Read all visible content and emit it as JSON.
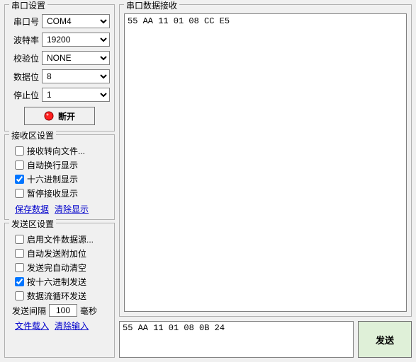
{
  "serial": {
    "title": "串口设置",
    "port_label": "串口号",
    "port_value": "COM4",
    "baud_label": "波特率",
    "baud_value": "19200",
    "parity_label": "校验位",
    "parity_value": "NONE",
    "data_label": "数据位",
    "data_value": "8",
    "stop_label": "停止位",
    "stop_value": "1",
    "disconnect_label": "断开"
  },
  "recv_settings": {
    "title": "接收区设置",
    "to_file": "接收转向文件...",
    "auto_wrap": "自动换行显示",
    "hex_display": "十六进制显示",
    "pause": "暂停接收显示",
    "save_link": "保存数据",
    "clear_link": "清除显示"
  },
  "send_settings": {
    "title": "发送区设置",
    "file_source": "启用文件数据源...",
    "auto_append": "自动发送附加位",
    "clear_after": "发送完自动清空",
    "hex_send": "按十六进制发送",
    "loop_send": "数据流循环发送",
    "interval_prefix": "发送间隔",
    "interval_value": "100",
    "interval_suffix": "毫秒",
    "load_file_link": "文件载入",
    "clear_input_link": "清除输入"
  },
  "recv_area": {
    "title": "串口数据接收",
    "content": "55 AA 11 01 08 CC E5"
  },
  "send_area": {
    "input_value": "55 AA 11 01 08 0B 24",
    "send_label": "发送"
  }
}
